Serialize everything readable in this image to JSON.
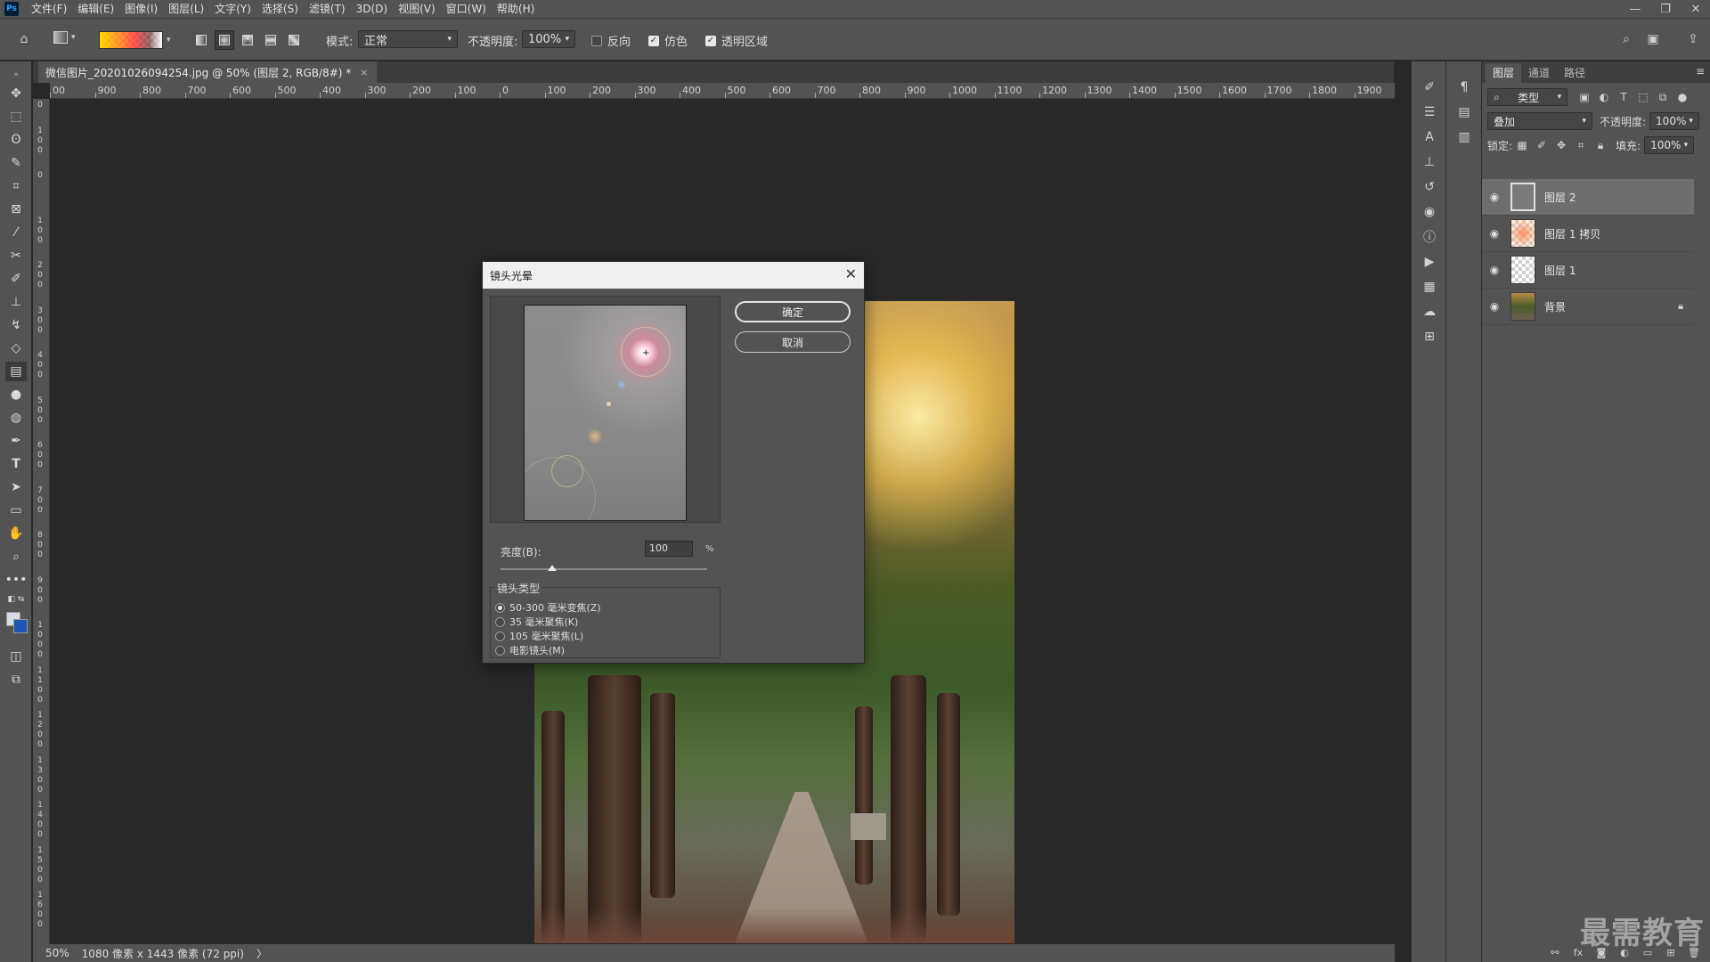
{
  "app": {
    "logo_text": "Ps"
  },
  "menu": [
    "文件(F)",
    "编辑(E)",
    "图像(I)",
    "图层(L)",
    "文字(Y)",
    "选择(S)",
    "滤镜(T)",
    "3D(D)",
    "视图(V)",
    "窗口(W)",
    "帮助(H)"
  ],
  "window_controls": {
    "minimize": "—",
    "restore": "❐",
    "close": "✕"
  },
  "options_bar": {
    "mode_label": "模式:",
    "mode_value": "正常",
    "opacity_label": "不透明度:",
    "opacity_value": "100%",
    "reverse_label": "反向",
    "reverse_checked": false,
    "dither_label": "仿色",
    "dither_checked": true,
    "transparency_label": "透明区域",
    "transparency_checked": true
  },
  "document": {
    "tab_title": "微信图片_20201026094254.jpg @ 50% (图层 2, RGB/8#) *",
    "tab_close": "×"
  },
  "ruler": {
    "h_labels": [
      "00",
      "900",
      "800",
      "700",
      "600",
      "500",
      "400",
      "300",
      "200",
      "100",
      "0",
      "100",
      "200",
      "300",
      "400",
      "500",
      "600",
      "700",
      "800",
      "900",
      "1000",
      "1100",
      "1200",
      "1300",
      "1400",
      "1500",
      "1600",
      "1700",
      "1800",
      "1900",
      "200"
    ],
    "v_labels": [
      "2 0 0",
      "1 0 0",
      "0",
      "1 0 0",
      "2 0 0",
      "3 0 0",
      "4 0 0",
      "5 0 0",
      "6 0 0",
      "7 0 0",
      "8 0 0",
      "9 0 0",
      "1 0 0 0",
      "1 1 0 0",
      "1 2 0 0",
      "1 3 0 0",
      "1 4 0 0",
      "1 5 0 0",
      "1 6 0 0"
    ]
  },
  "dialog": {
    "title": "镜头光晕",
    "ok_label": "确定",
    "cancel_label": "取消",
    "brightness_label": "亮度(B):",
    "brightness_value": "100",
    "brightness_unit": "%",
    "brightness_slider_fraction": 0.25,
    "lens_type_title": "镜头类型",
    "lens_options": [
      {
        "label": "50-300 毫米变焦(Z)",
        "selected": true
      },
      {
        "label": "35 毫米聚焦(K)",
        "selected": false
      },
      {
        "label": "105 毫米聚焦(L)",
        "selected": false
      },
      {
        "label": "电影镜头(M)",
        "selected": false
      }
    ]
  },
  "status": {
    "zoom": "50%",
    "info": "1080 像素 x 1443 像素 (72 ppi)",
    "arrow": "〉"
  },
  "layers_panel": {
    "tabs": [
      "图层",
      "通道",
      "路径"
    ],
    "active_tab": 0,
    "filter_kind": "类型",
    "blend_mode": "叠加",
    "opacity_label": "不透明度:",
    "opacity_value": "100%",
    "lock_label": "锁定:",
    "fill_label": "填充:",
    "fill_value": "100%",
    "layers": [
      {
        "name": "图层 2",
        "thumb": "gray",
        "selected": true,
        "locked": false
      },
      {
        "name": "图层 1 拷贝",
        "thumb": "checker-orange",
        "selected": false,
        "locked": false
      },
      {
        "name": "图层 1",
        "thumb": "checker",
        "selected": false,
        "locked": false
      },
      {
        "name": "背景",
        "thumb": "photo",
        "selected": false,
        "locked": true
      }
    ]
  },
  "watermark": "最需教育",
  "colors": {
    "panel_bg": "#535353",
    "canvas_bg": "#282828",
    "selected_layer": "#6e6e6e"
  }
}
